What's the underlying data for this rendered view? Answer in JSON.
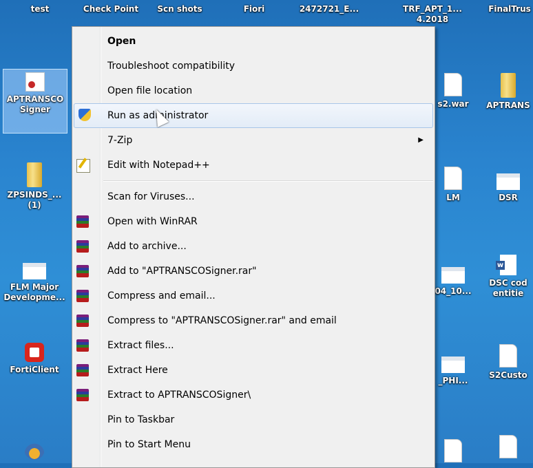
{
  "desktop": {
    "icons": [
      {
        "label": "test"
      },
      {
        "label": "Check Point"
      },
      {
        "label": "Scn shots"
      },
      {
        "label": "Fiori"
      },
      {
        "label": "2472721_E..."
      },
      {
        "label": "TRF_APT_1...\n4.2018"
      },
      {
        "label": "FinalTrus"
      },
      {
        "label": "APTRANSCO\nSigner"
      },
      {
        "label": "s2.war"
      },
      {
        "label": "APTRANS"
      },
      {
        "label": "ZPSINDS_...\n(1)"
      },
      {
        "label": "LM"
      },
      {
        "label": "DSR"
      },
      {
        "label": "FLM Major\nDevelopme..."
      },
      {
        "label": "04_10..."
      },
      {
        "label": "DSC cod\nentitie"
      },
      {
        "label": "FortiClient"
      },
      {
        "label": "_PHI..."
      },
      {
        "label": "S2Custo"
      }
    ]
  },
  "context_menu": {
    "items": [
      {
        "label": "Open",
        "icon": "",
        "bold": true
      },
      {
        "label": "Troubleshoot compatibility",
        "icon": ""
      },
      {
        "label": "Open file location",
        "icon": ""
      },
      {
        "label": "Run as administrator",
        "icon": "uac-shield-icon",
        "highlighted": true
      },
      {
        "label": "7-Zip",
        "icon": "",
        "submenu": true
      },
      {
        "label": "Edit with Notepad++",
        "icon": "notepad-plus-plus-icon"
      },
      {
        "label": "Scan for Viruses...",
        "icon": ""
      },
      {
        "label": "Open with WinRAR",
        "icon": "winrar-icon"
      },
      {
        "label": "Add to archive...",
        "icon": "winrar-icon"
      },
      {
        "label": "Add to \"APTRANSCOSigner.rar\"",
        "icon": "winrar-icon"
      },
      {
        "label": "Compress and email...",
        "icon": "winrar-icon"
      },
      {
        "label": "Compress to \"APTRANSCOSigner.rar\" and email",
        "icon": "winrar-icon"
      },
      {
        "label": "Extract files...",
        "icon": "winrar-icon"
      },
      {
        "label": "Extract Here",
        "icon": "winrar-icon"
      },
      {
        "label": "Extract to APTRANSCOSigner\\",
        "icon": "winrar-icon"
      },
      {
        "label": "Pin to Taskbar",
        "icon": ""
      },
      {
        "label": "Pin to Start Menu",
        "icon": ""
      }
    ],
    "submenu_arrow": "▶"
  }
}
